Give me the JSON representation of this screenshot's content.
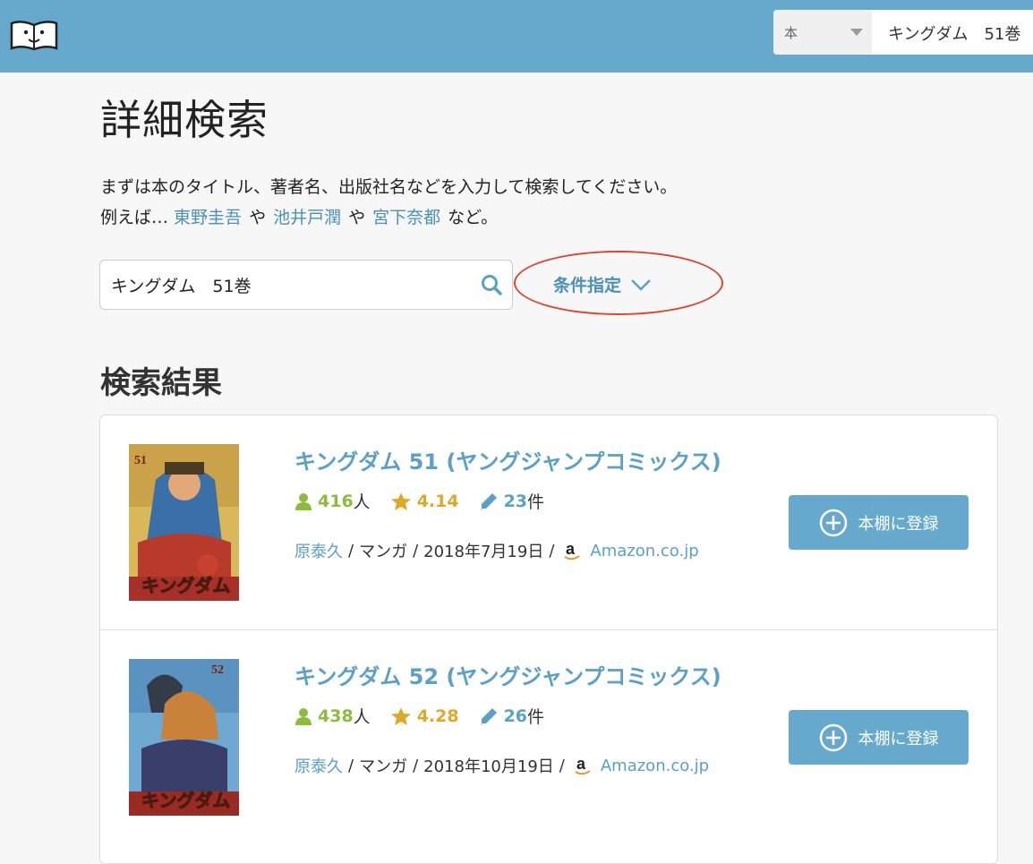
{
  "header": {
    "category_label": "本",
    "query": "キングダム　51巻"
  },
  "page": {
    "title": "詳細検索",
    "intro_line1": "まずは本のタイトル、著者名、出版社名などを入力して検索してください。",
    "intro_prefix": "例えば… ",
    "examples": [
      "東野圭吾",
      "池井戸潤",
      "宮下奈都"
    ],
    "example_joiner": "や",
    "intro_suffix": "など。"
  },
  "search": {
    "value": "キングダム　51巻",
    "conditions_label": "条件指定"
  },
  "results_title": "検索結果",
  "results": [
    {
      "title": "キングダム 51 (ヤングジャンプコミックス)",
      "readers": "416",
      "readers_unit": "人",
      "rating": "4.14",
      "reviews": "23",
      "reviews_unit": "件",
      "author": "原泰久",
      "genre": "マンガ",
      "date": "2018年7月19日",
      "store": "Amazon.co.jp",
      "register_label": "本棚に登録"
    },
    {
      "title": "キングダム 52 (ヤングジャンプコミックス)",
      "readers": "438",
      "readers_unit": "人",
      "rating": "4.28",
      "reviews": "26",
      "reviews_unit": "件",
      "author": "原泰久",
      "genre": "マンガ",
      "date": "2018年10月19日",
      "store": "Amazon.co.jp",
      "register_label": "本棚に登録"
    }
  ],
  "colors": {
    "header_bg": "#66a9cc",
    "link": "#5aa0c8",
    "highlight_circle": "#d9472f",
    "readers_green": "#8dbb3d",
    "rating_gold": "#e0a828"
  }
}
